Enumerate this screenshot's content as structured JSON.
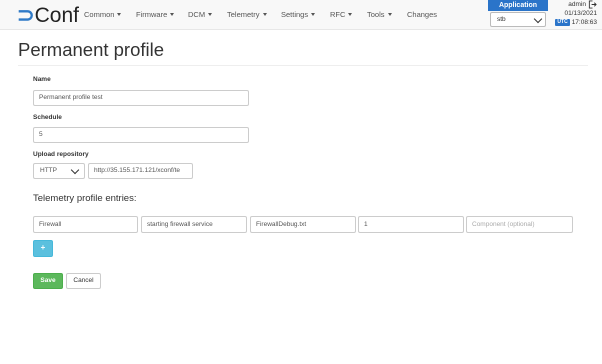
{
  "navbar": {
    "logo_mark": "⊃",
    "logo_text": "Conf",
    "menu": [
      {
        "label": "Common",
        "has_caret": true
      },
      {
        "label": "Firmware",
        "has_caret": true
      },
      {
        "label": "DCM",
        "has_caret": true
      },
      {
        "label": "Telemetry",
        "has_caret": true
      },
      {
        "label": "Settings",
        "has_caret": true
      },
      {
        "label": "RFC",
        "has_caret": true
      },
      {
        "label": "Tools",
        "has_caret": true
      },
      {
        "label": "Changes",
        "has_caret": false
      }
    ],
    "application": {
      "label": "Application",
      "selected": "stb"
    },
    "user": {
      "name": "admin",
      "date": "01/13/2021",
      "tz": "UTC",
      "time": "17:08:63"
    }
  },
  "page": {
    "title": "Permanent profile",
    "name": {
      "label": "Name",
      "value": "Permanent profile test"
    },
    "schedule": {
      "label": "Schedule",
      "value": "5"
    },
    "upload": {
      "label": "Upload repository",
      "protocol": "HTTP",
      "url": "http://35.155.171.121/xconf/te"
    },
    "entries_title": "Telemetry profile entries:",
    "entry": {
      "header": "Firewall",
      "content": "starting firewall service",
      "type": "FirewallDebug.txt",
      "polling": "1",
      "component_placeholder": "Component (optional)"
    },
    "add_label": "+",
    "save_label": "Save",
    "cancel_label": "Cancel"
  },
  "colors": {
    "accent": "#2a74c9",
    "save": "#5cb85c",
    "add": "#5bc0de"
  }
}
